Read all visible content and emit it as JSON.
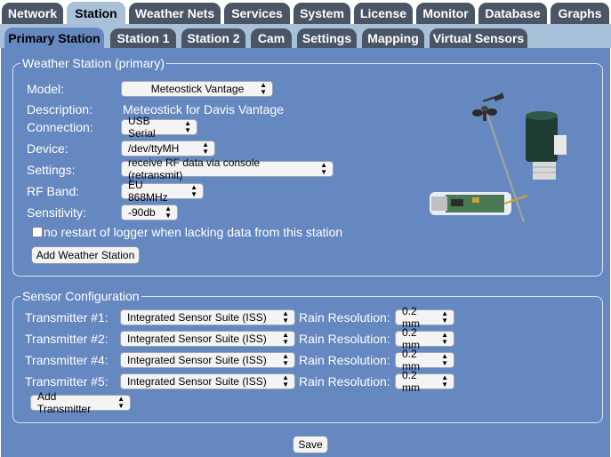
{
  "main_tabs": [
    {
      "label": "Network"
    },
    {
      "label": "Station"
    },
    {
      "label": "Weather Nets"
    },
    {
      "label": "Services"
    },
    {
      "label": "System"
    },
    {
      "label": "License"
    },
    {
      "label": "Monitor"
    },
    {
      "label": "Database"
    },
    {
      "label": "Graphs"
    }
  ],
  "sub_tabs": [
    {
      "label": "Primary Station"
    },
    {
      "label": "Station 1"
    },
    {
      "label": "Station 2"
    },
    {
      "label": "Cam"
    },
    {
      "label": "Settings"
    },
    {
      "label": "Mapping"
    },
    {
      "label": "Virtual Sensors"
    }
  ],
  "weather_station": {
    "legend": "Weather Station (primary)",
    "model_label": "Model:",
    "model_value": "Meteostick Vantage",
    "description_label": "Description:",
    "description_value": "Meteostick for Davis Vantage",
    "connection_label": "Connection:",
    "connection_value": "USB Serial",
    "device_label": "Device:",
    "device_value": "/dev/ttyMH",
    "settings_label": "Settings:",
    "settings_value": "receive RF data via console (retransmit)",
    "rf_band_label": "RF Band:",
    "rf_band_value": "EU 868MHz",
    "sensitivity_label": "Sensitivity:",
    "sensitivity_value": "-90db",
    "no_restart_label": "no restart of logger when lacking data from this station",
    "no_restart_checked": false,
    "add_button": "Add Weather Station"
  },
  "sensor_config": {
    "legend": "Sensor Configuration",
    "rain_label": "Rain Resolution:",
    "transmitters": [
      {
        "label": "Transmitter #1:",
        "type": "Integrated Sensor Suite (ISS)",
        "rain": "0.2 mm"
      },
      {
        "label": "Transmitter #2:",
        "type": "Integrated Sensor Suite (ISS)",
        "rain": "0.2 mm"
      },
      {
        "label": "Transmitter #4:",
        "type": "Integrated Sensor Suite (ISS)",
        "rain": "0.2 mm"
      },
      {
        "label": "Transmitter #5:",
        "type": "Integrated Sensor Suite (ISS)",
        "rain": "0.2 mm"
      }
    ],
    "add_transmitter": "Add Transmitter"
  },
  "save_button": "Save",
  "colors": {
    "panel_blue": "#6688c0",
    "band_light": "#a8c0d8",
    "tab_dark": "#4a5566"
  }
}
